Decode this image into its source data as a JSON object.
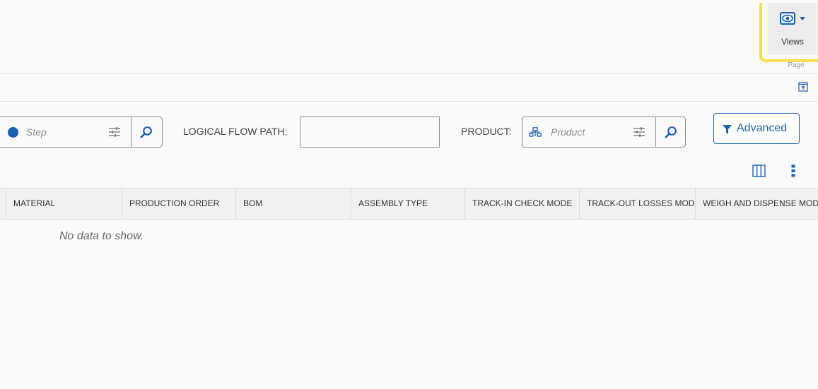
{
  "ribbon": {
    "views_label": "Views",
    "group_label": "Page",
    "accent_color": "#f5e050"
  },
  "filters": {
    "step": {
      "placeholder": "Step",
      "dot_color": "#1c5fb0"
    },
    "logical_flow_path": {
      "label": "LOGICAL FLOW PATH:",
      "value": ""
    },
    "product": {
      "label": "PRODUCT:",
      "placeholder": "Product"
    },
    "advanced_label": "Advanced"
  },
  "table": {
    "columns": [
      "MATERIAL",
      "PRODUCTION ORDER",
      "BOM",
      "ASSEMBLY TYPE",
      "TRACK-IN CHECK MODE",
      "TRACK-OUT LOSSES MODE",
      "WEIGH AND DISPENSE MODE"
    ],
    "empty_message": "No data to show."
  },
  "icons": {
    "views": "eye-icon",
    "collapse": "collapse-up-icon",
    "adjust": "sliders-icon",
    "search": "search-icon",
    "product": "product-icon",
    "filter": "funnel-icon",
    "columns": "columns-icon",
    "more": "kebab-icon"
  },
  "colors": {
    "primary": "#1c5fb0"
  }
}
